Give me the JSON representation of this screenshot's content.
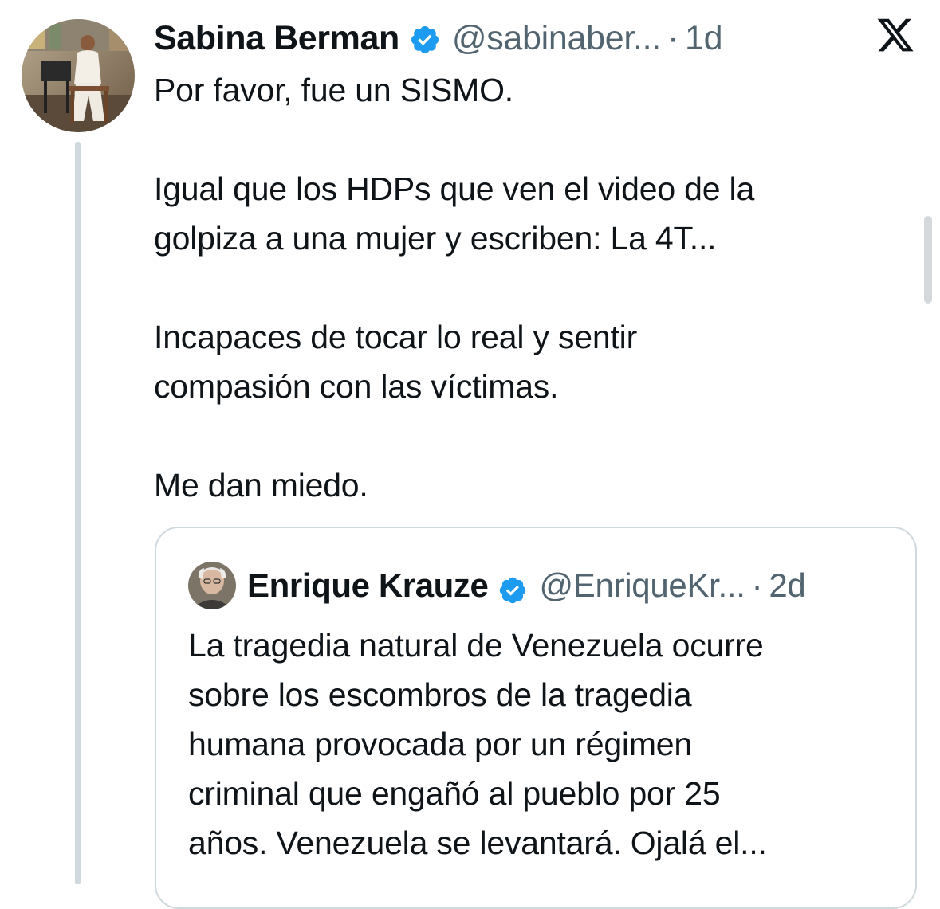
{
  "tweet": {
    "display_name": "Sabina Berman",
    "handle": "@sabinaber...",
    "separator": "·",
    "time": "1d",
    "verified_icon": "verified-badge-icon",
    "avatar_icon": "profile-photo",
    "lines": [
      "Por favor, fue un SISMO.",
      "Igual que los HDPs que ven el video de la",
      "golpiza a una mujer y escriben: La 4T...",
      "Incapaces de tocar lo real y sentir",
      "compasión con las víctimas.",
      "Me dan miedo."
    ]
  },
  "app": {
    "logo_icon": "x-logo-icon"
  },
  "quoted_tweet": {
    "display_name": "Enrique Krauze",
    "handle": "@EnriqueKr...",
    "separator": "·",
    "time": "2d",
    "verified_icon": "verified-badge-icon",
    "lines": [
      "La tragedia natural de Venezuela ocurre",
      "sobre los escombros de la tragedia",
      "humana provocada por un régimen",
      "criminal que engañó al pueblo por 25",
      "años. Venezuela se levantará. Ojalá el..."
    ]
  },
  "colors": {
    "verified": "#1d9bf0",
    "text": "#0f1419",
    "secondary": "#536471",
    "border": "#cfd9de"
  }
}
